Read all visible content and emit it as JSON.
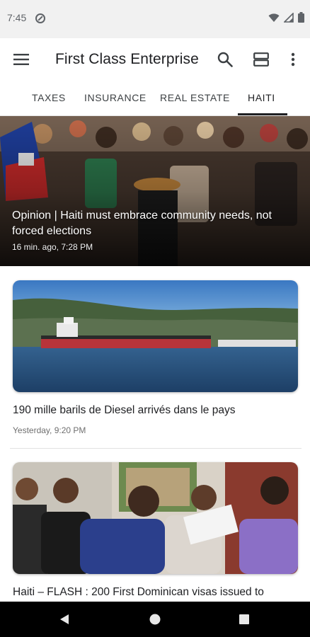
{
  "status_bar": {
    "time": "7:45",
    "icons": [
      "do-not-disturb-icon",
      "wifi-icon",
      "signal-icon",
      "battery-icon"
    ]
  },
  "app_bar": {
    "title": "First Class Enterprise",
    "icons": [
      "menu-icon",
      "search-icon",
      "layout-icon",
      "more-vert-icon"
    ]
  },
  "tabs": [
    {
      "label": "TAXES",
      "selected": false
    },
    {
      "label": "INSURANCE",
      "selected": false
    },
    {
      "label": "REAL ESTATE",
      "selected": false
    },
    {
      "label": "HAITI",
      "selected": true
    }
  ],
  "featured": {
    "title": "Opinion | Haiti must embrace community needs, not forced elections",
    "time": "16 min. ago, 7:28 PM"
  },
  "articles": [
    {
      "title": "190 mille barils de Diesel arrivés dans le pays",
      "time": "Yesterday, 9:20 PM"
    },
    {
      "title": "Haiti – FLASH : 200 First Dominican visas issued to",
      "time": ""
    }
  ],
  "nav_bar": {
    "icons": [
      "back-icon",
      "home-icon",
      "recents-icon"
    ]
  },
  "colors": {
    "status_bar_bg": "#f1f1f1",
    "nav_bar_bg": "#000000",
    "tab_indicator": "#202124"
  }
}
